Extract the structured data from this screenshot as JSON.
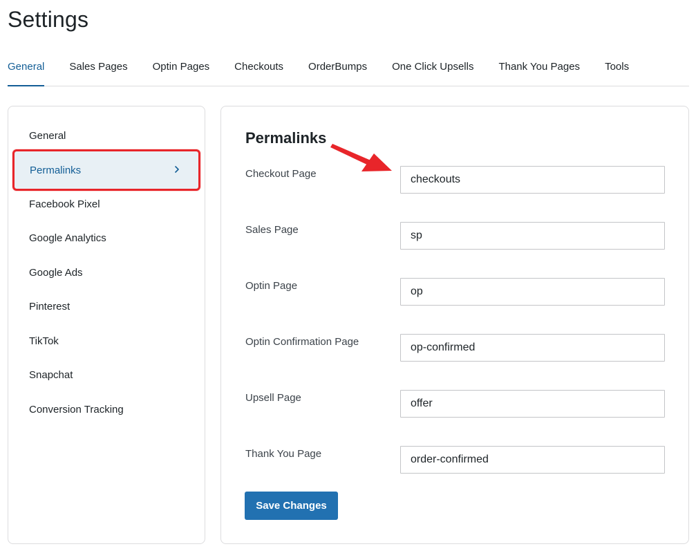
{
  "page": {
    "title": "Settings"
  },
  "tabs": [
    {
      "label": "General",
      "active": true
    },
    {
      "label": "Sales Pages"
    },
    {
      "label": "Optin Pages"
    },
    {
      "label": "Checkouts"
    },
    {
      "label": "OrderBumps"
    },
    {
      "label": "One Click Upsells"
    },
    {
      "label": "Thank You Pages"
    },
    {
      "label": "Tools"
    }
  ],
  "sidebar": {
    "items": [
      {
        "label": "General"
      },
      {
        "label": "Permalinks",
        "active": true,
        "icon": "chevron-right-icon"
      },
      {
        "label": "Facebook Pixel"
      },
      {
        "label": "Google Analytics"
      },
      {
        "label": "Google Ads"
      },
      {
        "label": "Pinterest"
      },
      {
        "label": "TikTok"
      },
      {
        "label": "Snapchat"
      },
      {
        "label": "Conversion Tracking"
      }
    ]
  },
  "main": {
    "title": "Permalinks",
    "fields": [
      {
        "label": "Checkout Page",
        "value": "checkouts"
      },
      {
        "label": "Sales Page",
        "value": "sp"
      },
      {
        "label": "Optin Page",
        "value": "op"
      },
      {
        "label": "Optin Confirmation Page",
        "value": "op-confirmed"
      },
      {
        "label": "Upsell Page",
        "value": "offer"
      },
      {
        "label": "Thank You Page",
        "value": "order-confirmed"
      }
    ],
    "save_label": "Save Changes"
  },
  "colors": {
    "accent": "#135e96",
    "button": "#2271b1",
    "highlight": "#e8252a",
    "active_bg": "#e8f0f5"
  }
}
